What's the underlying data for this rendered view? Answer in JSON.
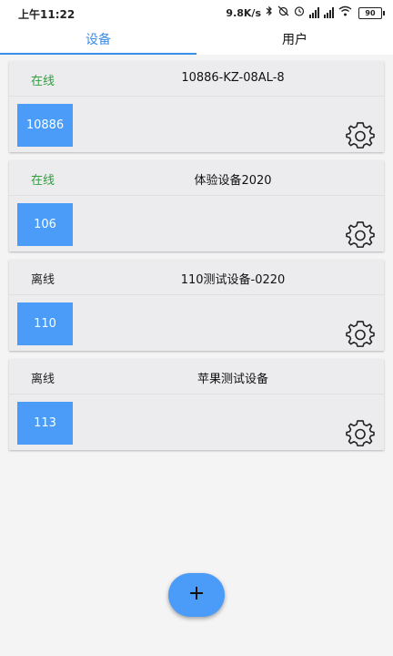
{
  "status_bar": {
    "time": "上午11:22",
    "network_speed": "9.8K/s",
    "battery": "90",
    "icons": [
      "bluetooth-icon",
      "alarm-off-icon",
      "clock-icon",
      "hd-signal-icon",
      "signal-icon",
      "wifi-icon",
      "battery-icon"
    ]
  },
  "tabs": [
    {
      "label": "设备",
      "active": true
    },
    {
      "label": "用户",
      "active": false
    }
  ],
  "devices": [
    {
      "status": "在线",
      "online": true,
      "name": "10886-KZ-08AL-8",
      "id": "10886"
    },
    {
      "status": "在线",
      "online": true,
      "name": "体验设备2020",
      "id": "106"
    },
    {
      "status": "离线",
      "online": false,
      "name": "110测试设备-0220",
      "id": "110"
    },
    {
      "status": "离线",
      "online": false,
      "name": "苹果测试设备",
      "id": "113"
    }
  ],
  "colors": {
    "accent": "#3a8ee6",
    "badge": "#4a9cf8",
    "online": "#2e9e3e",
    "card_bg": "#ececee",
    "page_bg": "#f4f4f4"
  },
  "fab": {
    "icon": "plus-icon"
  }
}
